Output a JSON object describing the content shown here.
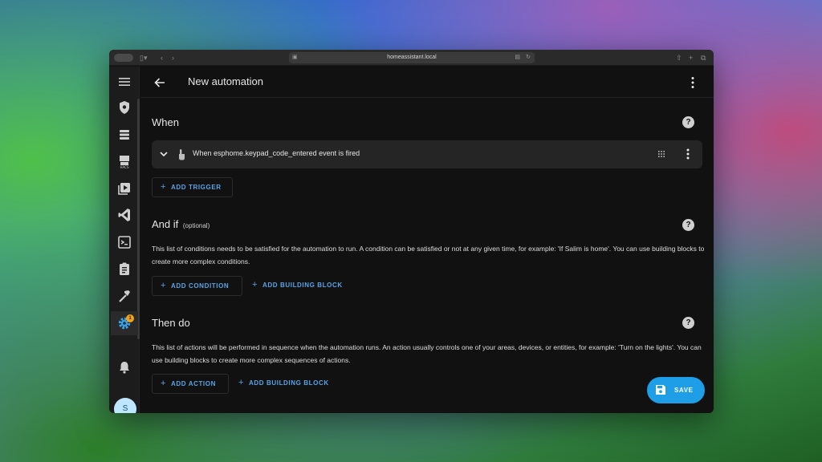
{
  "browser": {
    "url": "homeassistant.local",
    "icons": [
      "sidebar-toggle-icon",
      "back-nav-icon",
      "forward-nav-icon",
      "share-icon",
      "new-tab-icon",
      "tabs-icon"
    ]
  },
  "sidebar": {
    "items": [
      {
        "name": "menu-icon"
      },
      {
        "name": "shield-icon"
      },
      {
        "name": "database-icon"
      },
      {
        "name": "hacs-icon"
      },
      {
        "name": "media-icon"
      },
      {
        "name": "vscode-icon"
      },
      {
        "name": "terminal-icon"
      },
      {
        "name": "clipboard-icon"
      },
      {
        "name": "hammer-icon"
      },
      {
        "name": "settings-icon"
      }
    ],
    "settings_badge": "1",
    "avatar_initial": "S"
  },
  "header": {
    "title": "New automation"
  },
  "when": {
    "title": "When",
    "trigger_text": "When esphome.keypad_code_entered event is fired",
    "add_trigger": "ADD TRIGGER"
  },
  "and_if": {
    "title": "And if",
    "optional": "(optional)",
    "description": "This list of conditions needs to be satisfied for the automation to run. A condition can be satisfied or not at any given time, for example: 'If Salim is home'. You can use building blocks to create more complex conditions.",
    "add_condition": "ADD CONDITION",
    "add_building_block": "ADD BUILDING BLOCK"
  },
  "then_do": {
    "title": "Then do",
    "description": "This list of actions will be performed in sequence when the automation runs. An action usually controls one of your areas, devices, or entities, for example: 'Turn on the lights'. You can use building blocks to create more complex sequences of actions.",
    "add_action": "ADD ACTION",
    "add_building_block": "ADD BUILDING BLOCK"
  },
  "help_glyph": "?",
  "plus_glyph": "+",
  "save_label": "SAVE",
  "colors": {
    "accent": "#5aa4e6",
    "save_button": "#1d9ee6",
    "background": "#111111",
    "card": "#252525",
    "badge": "#f3a318"
  }
}
